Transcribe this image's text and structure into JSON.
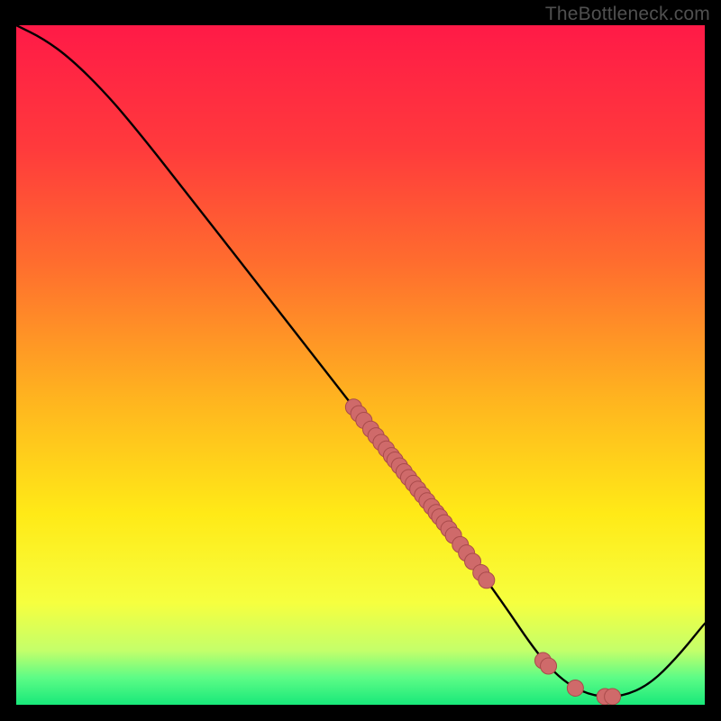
{
  "watermark": "TheBottleneck.com",
  "colors": {
    "gradient_stops": [
      {
        "offset": 0.0,
        "color": "#ff1a47"
      },
      {
        "offset": 0.18,
        "color": "#ff3a3c"
      },
      {
        "offset": 0.35,
        "color": "#ff6d2e"
      },
      {
        "offset": 0.55,
        "color": "#ffb41f"
      },
      {
        "offset": 0.72,
        "color": "#ffea17"
      },
      {
        "offset": 0.85,
        "color": "#f6ff3f"
      },
      {
        "offset": 0.92,
        "color": "#c4ff6a"
      },
      {
        "offset": 0.96,
        "color": "#5dfc86"
      },
      {
        "offset": 1.0,
        "color": "#18e87a"
      }
    ],
    "curve": "#000000",
    "dot_fill": "#cf6a6a",
    "dot_stroke": "#a94b4b"
  },
  "chart_data": {
    "type": "line",
    "title": "",
    "xlabel": "",
    "ylabel": "",
    "xlim": [
      0,
      100
    ],
    "ylim": [
      0,
      100
    ],
    "curve": [
      {
        "x": 0,
        "y": 100
      },
      {
        "x": 4,
        "y": 98
      },
      {
        "x": 8,
        "y": 95
      },
      {
        "x": 13,
        "y": 90
      },
      {
        "x": 18,
        "y": 84
      },
      {
        "x": 25,
        "y": 75
      },
      {
        "x": 35,
        "y": 62
      },
      {
        "x": 45,
        "y": 49
      },
      {
        "x": 55,
        "y": 36
      },
      {
        "x": 62,
        "y": 27
      },
      {
        "x": 70,
        "y": 16
      },
      {
        "x": 76,
        "y": 7
      },
      {
        "x": 80,
        "y": 3
      },
      {
        "x": 84,
        "y": 1.2
      },
      {
        "x": 88,
        "y": 1.2
      },
      {
        "x": 92,
        "y": 3
      },
      {
        "x": 96,
        "y": 7
      },
      {
        "x": 100,
        "y": 12
      }
    ],
    "dot_clusters": [
      {
        "x_start": 49.0,
        "x_end": 50.5,
        "count": 3
      },
      {
        "x_start": 51.5,
        "x_end": 54.5,
        "count": 5
      },
      {
        "x_start": 55.0,
        "x_end": 61.0,
        "count": 10
      },
      {
        "x_start": 61.5,
        "x_end": 63.5,
        "count": 4
      },
      {
        "x_start": 64.5,
        "x_end": 66.3,
        "count": 3
      },
      {
        "x_start": 67.5,
        "x_end": 68.3,
        "count": 2
      },
      {
        "x_start": 76.5,
        "x_end": 77.3,
        "count": 2
      },
      {
        "x_start": 80.8,
        "x_end": 81.6,
        "count": 1
      },
      {
        "x_start": 85.5,
        "x_end": 86.6,
        "count": 2
      }
    ],
    "dot_radius": 9
  }
}
